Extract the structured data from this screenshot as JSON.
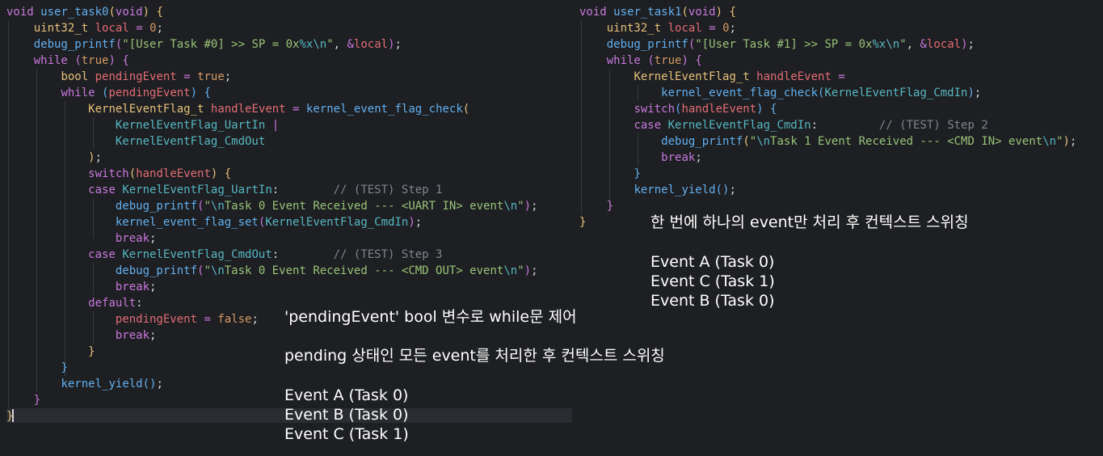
{
  "left_code": {
    "lines": [
      [
        [
          "t-kw",
          "void"
        ],
        [
          "t-plain",
          " "
        ],
        [
          "t-fn",
          "user_task0"
        ],
        [
          "t-p1",
          "("
        ],
        [
          "t-kw",
          "void"
        ],
        [
          "t-p1",
          ")"
        ],
        [
          "t-plain",
          " "
        ],
        [
          "t-p1",
          "{"
        ]
      ],
      [
        [
          "t-plain",
          "    "
        ],
        [
          "t-ty",
          "uint32_t"
        ],
        [
          "t-plain",
          " "
        ],
        [
          "t-var",
          "local"
        ],
        [
          "t-plain",
          " "
        ],
        [
          "t-op",
          "="
        ],
        [
          "t-plain",
          " "
        ],
        [
          "t-num",
          "0"
        ],
        [
          "t-plain",
          ";"
        ]
      ],
      [
        [
          "t-plain",
          "    "
        ],
        [
          "t-fn",
          "debug_printf"
        ],
        [
          "t-p2",
          "("
        ],
        [
          "t-str",
          "\"[User Task #0] >> SP = 0x"
        ],
        [
          "t-esc",
          "%x\\n"
        ],
        [
          "t-str",
          "\""
        ],
        [
          "t-plain",
          ", "
        ],
        [
          "t-op",
          "&"
        ],
        [
          "t-var",
          "local"
        ],
        [
          "t-p2",
          ")"
        ],
        [
          "t-plain",
          ";"
        ]
      ],
      [
        [
          "t-plain",
          "    "
        ],
        [
          "t-kw",
          "while"
        ],
        [
          "t-plain",
          " "
        ],
        [
          "t-p2",
          "("
        ],
        [
          "t-num",
          "true"
        ],
        [
          "t-p2",
          ")"
        ],
        [
          "t-plain",
          " "
        ],
        [
          "t-p2",
          "{"
        ]
      ],
      [
        [
          "t-plain",
          "        "
        ],
        [
          "t-ty",
          "bool"
        ],
        [
          "t-plain",
          " "
        ],
        [
          "t-var",
          "pendingEvent"
        ],
        [
          "t-plain",
          " "
        ],
        [
          "t-op",
          "="
        ],
        [
          "t-plain",
          " "
        ],
        [
          "t-num",
          "true"
        ],
        [
          "t-plain",
          ";"
        ]
      ],
      [
        [
          "t-plain",
          "        "
        ],
        [
          "t-kw",
          "while"
        ],
        [
          "t-plain",
          " "
        ],
        [
          "t-p3",
          "("
        ],
        [
          "t-var",
          "pendingEvent"
        ],
        [
          "t-p3",
          ")"
        ],
        [
          "t-plain",
          " "
        ],
        [
          "t-p3",
          "{"
        ]
      ],
      [
        [
          "t-plain",
          "            "
        ],
        [
          "t-ty",
          "KernelEventFlag_t"
        ],
        [
          "t-plain",
          " "
        ],
        [
          "t-var",
          "handleEvent"
        ],
        [
          "t-plain",
          " "
        ],
        [
          "t-op",
          "="
        ],
        [
          "t-plain",
          " "
        ],
        [
          "t-fn",
          "kernel_event_flag_check"
        ],
        [
          "t-p1",
          "("
        ]
      ],
      [
        [
          "t-plain",
          "                "
        ],
        [
          "t-enum",
          "KernelEventFlag_UartIn"
        ],
        [
          "t-plain",
          " "
        ],
        [
          "t-op",
          "|"
        ]
      ],
      [
        [
          "t-plain",
          "                "
        ],
        [
          "t-enum",
          "KernelEventFlag_CmdOut"
        ]
      ],
      [
        [
          "t-plain",
          "            "
        ],
        [
          "t-p1",
          ")"
        ],
        [
          "t-plain",
          ";"
        ]
      ],
      [
        [
          "t-plain",
          "            "
        ],
        [
          "t-kw",
          "switch"
        ],
        [
          "t-p1",
          "("
        ],
        [
          "t-var",
          "handleEvent"
        ],
        [
          "t-p1",
          ")"
        ],
        [
          "t-plain",
          " "
        ],
        [
          "t-p1",
          "{"
        ]
      ],
      [
        [
          "t-plain",
          "            "
        ],
        [
          "t-kw",
          "case"
        ],
        [
          "t-plain",
          " "
        ],
        [
          "t-enum",
          "KernelEventFlag_UartIn"
        ],
        [
          "t-plain",
          ":        "
        ],
        [
          "t-cm",
          "// (TEST) Step 1"
        ]
      ],
      [
        [
          "t-plain",
          "                "
        ],
        [
          "t-fn",
          "debug_printf"
        ],
        [
          "t-p2",
          "("
        ],
        [
          "t-str",
          "\""
        ],
        [
          "t-esc",
          "\\n"
        ],
        [
          "t-str",
          "Task 0 Event Received --- <UART IN> event"
        ],
        [
          "t-esc",
          "\\n"
        ],
        [
          "t-str",
          "\""
        ],
        [
          "t-p2",
          ")"
        ],
        [
          "t-plain",
          ";"
        ]
      ],
      [
        [
          "t-plain",
          "                "
        ],
        [
          "t-fn",
          "kernel_event_flag_set"
        ],
        [
          "t-p2",
          "("
        ],
        [
          "t-enum",
          "KernelEventFlag_CmdIn"
        ],
        [
          "t-p2",
          ")"
        ],
        [
          "t-plain",
          ";"
        ]
      ],
      [
        [
          "t-plain",
          "                "
        ],
        [
          "t-kw",
          "break"
        ],
        [
          "t-plain",
          ";"
        ]
      ],
      [
        [
          "t-plain",
          "            "
        ],
        [
          "t-kw",
          "case"
        ],
        [
          "t-plain",
          " "
        ],
        [
          "t-enum",
          "KernelEventFlag_CmdOut"
        ],
        [
          "t-plain",
          ":        "
        ],
        [
          "t-cm",
          "// (TEST) Step 3"
        ]
      ],
      [
        [
          "t-plain",
          "                "
        ],
        [
          "t-fn",
          "debug_printf"
        ],
        [
          "t-p2",
          "("
        ],
        [
          "t-str",
          "\""
        ],
        [
          "t-esc",
          "\\n"
        ],
        [
          "t-str",
          "Task 0 Event Received --- <CMD OUT> event"
        ],
        [
          "t-esc",
          "\\n"
        ],
        [
          "t-str",
          "\""
        ],
        [
          "t-p2",
          ")"
        ],
        [
          "t-plain",
          ";"
        ]
      ],
      [
        [
          "t-plain",
          "                "
        ],
        [
          "t-kw",
          "break"
        ],
        [
          "t-plain",
          ";"
        ]
      ],
      [
        [
          "t-plain",
          "            "
        ],
        [
          "t-kw",
          "default"
        ],
        [
          "t-plain",
          ":"
        ]
      ],
      [
        [
          "t-plain",
          "                "
        ],
        [
          "t-var",
          "pendingEvent"
        ],
        [
          "t-plain",
          " "
        ],
        [
          "t-op",
          "="
        ],
        [
          "t-plain",
          " "
        ],
        [
          "t-num",
          "false"
        ],
        [
          "t-plain",
          ";"
        ]
      ],
      [
        [
          "t-plain",
          "                "
        ],
        [
          "t-kw",
          "break"
        ],
        [
          "t-plain",
          ";"
        ]
      ],
      [
        [
          "t-plain",
          "            "
        ],
        [
          "t-p1",
          "}"
        ]
      ],
      [
        [
          "t-plain",
          "        "
        ],
        [
          "t-p3",
          "}"
        ]
      ],
      [
        [
          "t-plain",
          "        "
        ],
        [
          "t-fn",
          "kernel_yield"
        ],
        [
          "t-p3",
          "()"
        ],
        [
          "t-plain",
          ";"
        ]
      ],
      [
        [
          "t-plain",
          "    "
        ],
        [
          "t-p2",
          "}"
        ]
      ],
      [
        [
          "t-p1",
          "}"
        ]
      ]
    ]
  },
  "right_code": {
    "lines": [
      [
        [
          "t-kw",
          "void"
        ],
        [
          "t-plain",
          " "
        ],
        [
          "t-fn",
          "user_task1"
        ],
        [
          "t-p1",
          "("
        ],
        [
          "t-kw",
          "void"
        ],
        [
          "t-p1",
          ")"
        ],
        [
          "t-plain",
          " "
        ],
        [
          "t-p1",
          "{"
        ]
      ],
      [
        [
          "t-plain",
          "    "
        ],
        [
          "t-ty",
          "uint32_t"
        ],
        [
          "t-plain",
          " "
        ],
        [
          "t-var",
          "local"
        ],
        [
          "t-plain",
          " "
        ],
        [
          "t-op",
          "="
        ],
        [
          "t-plain",
          " "
        ],
        [
          "t-num",
          "0"
        ],
        [
          "t-plain",
          ";"
        ]
      ],
      [
        [
          "t-plain",
          "    "
        ],
        [
          "t-fn",
          "debug_printf"
        ],
        [
          "t-p2",
          "("
        ],
        [
          "t-str",
          "\"[User Task #1] >> SP = 0x"
        ],
        [
          "t-esc",
          "%x\\n"
        ],
        [
          "t-str",
          "\""
        ],
        [
          "t-plain",
          ", "
        ],
        [
          "t-op",
          "&"
        ],
        [
          "t-var",
          "local"
        ],
        [
          "t-p2",
          ")"
        ],
        [
          "t-plain",
          ";"
        ]
      ],
      [
        [
          "t-plain",
          "    "
        ],
        [
          "t-kw",
          "while"
        ],
        [
          "t-plain",
          " "
        ],
        [
          "t-p2",
          "("
        ],
        [
          "t-num",
          "true"
        ],
        [
          "t-p2",
          ")"
        ],
        [
          "t-plain",
          " "
        ],
        [
          "t-p2",
          "{"
        ]
      ],
      [
        [
          "t-plain",
          "        "
        ],
        [
          "t-ty",
          "KernelEventFlag_t"
        ],
        [
          "t-plain",
          " "
        ],
        [
          "t-var",
          "handleEvent"
        ],
        [
          "t-plain",
          " "
        ],
        [
          "t-op",
          "="
        ]
      ],
      [
        [
          "t-plain",
          "            "
        ],
        [
          "t-fn",
          "kernel_event_flag_check"
        ],
        [
          "t-p3",
          "("
        ],
        [
          "t-enum",
          "KernelEventFlag_CmdIn"
        ],
        [
          "t-p3",
          ")"
        ],
        [
          "t-plain",
          ";"
        ]
      ],
      [
        [
          "t-plain",
          "        "
        ],
        [
          "t-kw",
          "switch"
        ],
        [
          "t-p3",
          "("
        ],
        [
          "t-var",
          "handleEvent"
        ],
        [
          "t-p3",
          ")"
        ],
        [
          "t-plain",
          " "
        ],
        [
          "t-p3",
          "{"
        ]
      ],
      [
        [
          "t-plain",
          "        "
        ],
        [
          "t-kw",
          "case"
        ],
        [
          "t-plain",
          " "
        ],
        [
          "t-enum",
          "KernelEventFlag_CmdIn"
        ],
        [
          "t-plain",
          ":         "
        ],
        [
          "t-cm",
          "// (TEST) Step 2"
        ]
      ],
      [
        [
          "t-plain",
          "            "
        ],
        [
          "t-fn",
          "debug_printf"
        ],
        [
          "t-p1",
          "("
        ],
        [
          "t-str",
          "\""
        ],
        [
          "t-esc",
          "\\n"
        ],
        [
          "t-str",
          "Task 1 Event Received --- <CMD IN> event"
        ],
        [
          "t-esc",
          "\\n"
        ],
        [
          "t-str",
          "\""
        ],
        [
          "t-p1",
          ")"
        ],
        [
          "t-plain",
          ";"
        ]
      ],
      [
        [
          "t-plain",
          "            "
        ],
        [
          "t-kw",
          "break"
        ],
        [
          "t-plain",
          ";"
        ]
      ],
      [
        [
          "t-plain",
          "        "
        ],
        [
          "t-p3",
          "}"
        ]
      ],
      [
        [
          "t-plain",
          "        "
        ],
        [
          "t-fn",
          "kernel_yield"
        ],
        [
          "t-p3",
          "()"
        ],
        [
          "t-plain",
          ";"
        ]
      ],
      [
        [
          "t-plain",
          "    "
        ],
        [
          "t-p2",
          "}"
        ]
      ],
      [
        [
          "t-p1",
          "}"
        ]
      ]
    ]
  },
  "notes": {
    "left_title": "'pendingEvent' bool 변수로 while문 제어",
    "left_desc": "pending 상태인 모든 event를 처리한 후 컨텍스트 스위칭",
    "left_events": "Event A (Task 0)\nEvent B (Task 0)\nEvent C (Task 1)",
    "right_desc": "한 번에 하나의 event만 처리 후 컨텍스트 스위칭",
    "right_events": "Event A (Task 0)\nEvent C (Task 1)\nEvent B (Task 0)"
  }
}
